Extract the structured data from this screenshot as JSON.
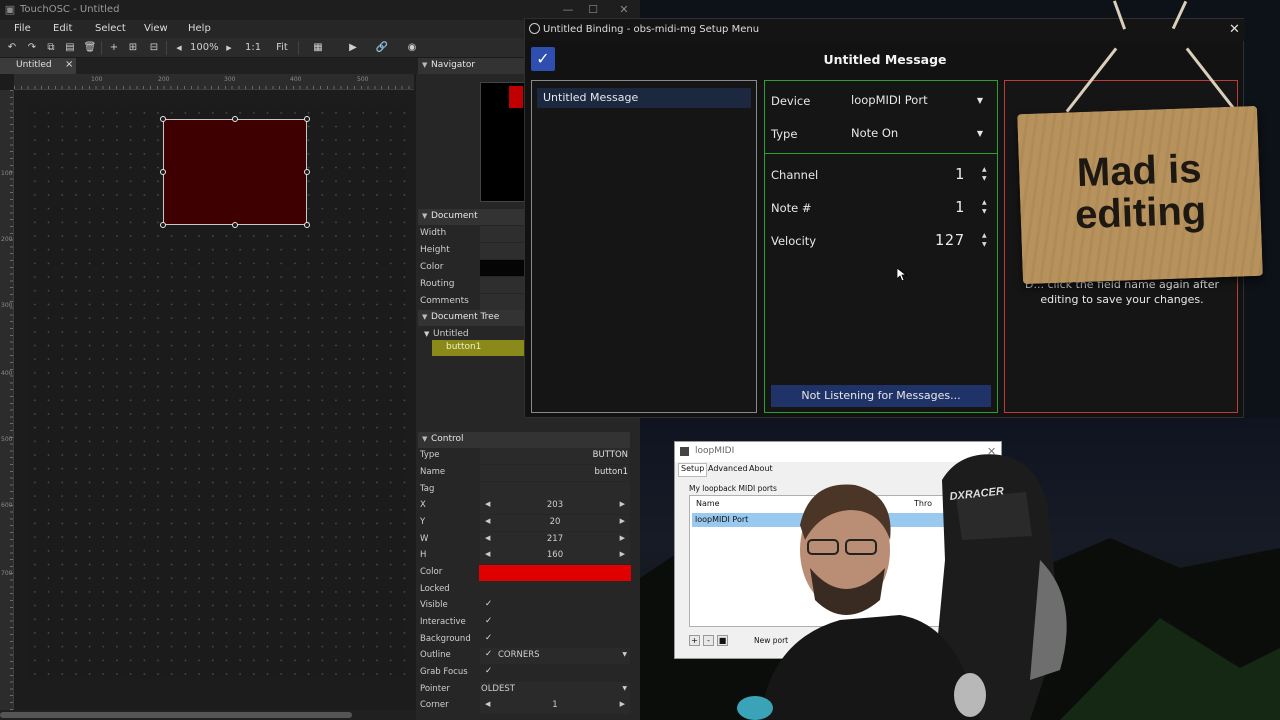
{
  "touchosc": {
    "window_title": "TouchOSC - Untitled",
    "menu": [
      "File",
      "Edit",
      "Select",
      "View",
      "Help"
    ],
    "toolbar": {
      "zoom": "100%",
      "ratio": "1:1",
      "fit": "Fit"
    },
    "tab": {
      "label": "Untitled",
      "close": "×"
    },
    "ruler_ticks": [
      "100",
      "200",
      "300",
      "400",
      "500"
    ],
    "ruler_ticks_v": [
      "100",
      "200",
      "300",
      "400",
      "500",
      "600",
      "700"
    ],
    "navigator": {
      "title": "Navigator"
    },
    "document": {
      "title": "Document",
      "fields": [
        "Width",
        "Height",
        "Color",
        "Routing",
        "Comments"
      ]
    },
    "tree": {
      "title": "Document Tree",
      "root": "Untitled",
      "child": "button1"
    },
    "control": {
      "title": "Control",
      "type_label": "Type",
      "type_value": "BUTTON",
      "name_label": "Name",
      "name_value": "button1",
      "tag_label": "Tag",
      "x_label": "X",
      "x_value": "203",
      "y_label": "Y",
      "y_value": "20",
      "w_label": "W",
      "w_value": "217",
      "h_label": "H",
      "h_value": "160",
      "color_label": "Color",
      "color_value": "#e00000",
      "locked_label": "Locked",
      "visible_label": "Visible",
      "interactive_label": "Interactive",
      "background_label": "Background",
      "outline_label": "Outline",
      "outline_value": "CORNERS",
      "grabfocus_label": "Grab Focus",
      "pointer_label": "Pointer",
      "pointer_value": "OLDEST",
      "corner_label": "Corner",
      "corner_value": "1"
    }
  },
  "binding": {
    "window_title": "Untitled Binding - obs-midi-mg Setup Menu",
    "heading": "Untitled Message",
    "message_item": "Untitled Message",
    "device_label": "Device",
    "device_value": "loopMIDI Port",
    "type_label": "Type",
    "type_value": "Note On",
    "channel_label": "Channel",
    "channel_value": "1",
    "note_label": "Note #",
    "note_value": "1",
    "velocity_label": "Velocity",
    "velocity_value": "127",
    "listen_button": "Not Listening for Messages...",
    "help_text": "Double click the field name again after editing to save your changes.",
    "help_text_visible": "D... click the field name again after editing to save your changes."
  },
  "sign": {
    "text_line1": "Mad is",
    "text_line2": "editing"
  },
  "loopmidi": {
    "title": "loopMIDI",
    "tabs": [
      "Setup",
      "Advanced",
      "About"
    ],
    "group_label": "My loopback MIDI ports",
    "col_name": "Name",
    "col_throughput": "Thro",
    "port_name": "loopMIDI Port",
    "new_port_label": "New port"
  },
  "colors": {
    "accent_blue": "#2e4fb0",
    "green_border": "#2ca02c",
    "red_border": "#c03a3a",
    "button_fill": "#3e0000",
    "tree_selected": "#8a8a1a"
  }
}
